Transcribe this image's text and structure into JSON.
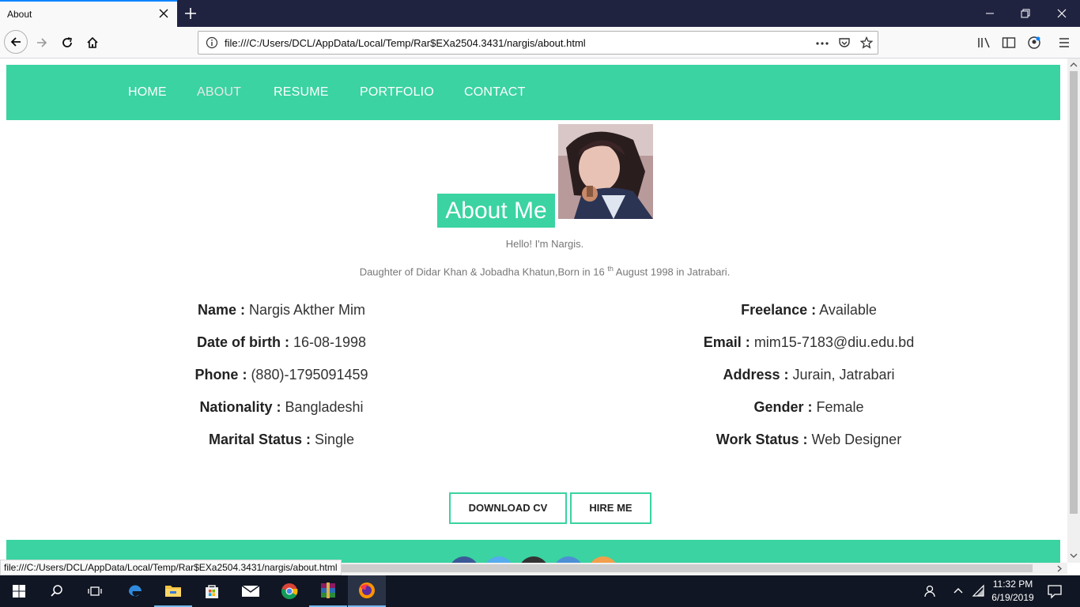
{
  "browser": {
    "tab_title": "About",
    "url": "file:///C:/Users/DCL/AppData/Local/Temp/Rar$EXa2504.3431/nargis/about.html",
    "status_url": "file:///C:/Users/DCL/AppData/Local/Temp/Rar$EXa2504.3431/nargis/about.html",
    "icons": [
      "close-icon",
      "plus-icon",
      "minimize-icon",
      "restore-icon",
      "window-close-icon",
      "back-icon",
      "forward-icon",
      "reload-icon",
      "home-icon",
      "info-icon",
      "more-icon",
      "pocket-icon",
      "bookmark-star-icon",
      "library-icon",
      "sidebar-icon",
      "account-icon",
      "menu-icon"
    ]
  },
  "nav": {
    "items": [
      {
        "label": "HOME"
      },
      {
        "label": "ABOUT"
      },
      {
        "label": "RESUME"
      },
      {
        "label": "PORTFOLIO"
      },
      {
        "label": "CONTACT"
      }
    ],
    "active": "ABOUT"
  },
  "about": {
    "title": "About Me",
    "intro": "Hello! I'm Nargis.",
    "bio_before": "Daughter of Didar Khan & Jobadha Khatun,Born in 16 ",
    "bio_sup": "th",
    "bio_after": " August 1998 in Jatrabari."
  },
  "info_left": [
    {
      "label": "Name :",
      "value": " Nargis Akther Mim"
    },
    {
      "label": "Date of birth :",
      "value": " 16-08-1998"
    },
    {
      "label": "Phone :",
      "value": " (880)-1795091459"
    },
    {
      "label": "Nationality :",
      "value": " Bangladeshi"
    },
    {
      "label": "Marital Status :",
      "value": " Single"
    }
  ],
  "info_right": [
    {
      "label": "Freelance :",
      "value": " Available"
    },
    {
      "label": "Email :",
      "value": " mim15-7183@diu.edu.bd"
    },
    {
      "label": "Address :",
      "value": " Jurain, Jatrabari"
    },
    {
      "label": "Gender :",
      "value": " Female"
    },
    {
      "label": "Work Status :",
      "value": " Web Designer"
    }
  ],
  "buttons": {
    "download_cv": "DOWNLOAD CV",
    "hire_me": "HIRE ME"
  },
  "colors": {
    "accent": "#3ad3a1",
    "social": [
      "#3b5998",
      "#55acee",
      "#333333",
      "#4c8fd6",
      "#f0a04b"
    ]
  },
  "taskbar": {
    "time": "11:32 PM",
    "date": "6/19/2019",
    "apps": [
      "start-icon",
      "search-icon",
      "task-view-icon",
      "edge-icon",
      "file-explorer-icon",
      "store-icon",
      "mail-icon",
      "chrome-icon",
      "winrar-icon",
      "firefox-icon"
    ]
  }
}
